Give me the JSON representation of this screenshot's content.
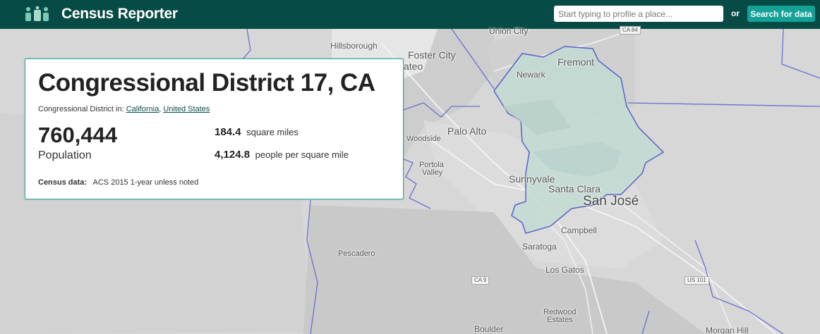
{
  "header": {
    "app_name": "Census Reporter",
    "search_placeholder": "Start typing to profile a place...",
    "or_label": "or",
    "search_button": "Search for data"
  },
  "profile": {
    "title": "Congressional District 17, CA",
    "parents_prefix": "Congressional District in:",
    "parent_links": [
      "California",
      "United States"
    ],
    "parent_separator": ",",
    "population_value": "760,444",
    "population_label": "Population",
    "area_value": "184.4",
    "area_unit": "square miles",
    "density_value": "4,124.8",
    "density_unit": "people per square mile",
    "census_label": "Census data:",
    "census_value": "ACS 2015 1-year unless noted"
  },
  "map": {
    "labels": [
      "Union City",
      "Hillsborough",
      "Foster City",
      "ateo",
      "Fremont",
      "Newark",
      "Palo Alto",
      "Woodside",
      "Portola",
      "Valley",
      "Sunnyvale",
      "Santa Clara",
      "San José",
      "Campbell",
      "Saratoga",
      "Los Gatos",
      "Pescadero",
      "Redwood",
      "Estates",
      "Boulder",
      "Morgan Hill"
    ],
    "shields": [
      "CA 84",
      "CA 9",
      "US 101"
    ],
    "colors": {
      "land": "#d9d9d9",
      "urban": "#cfcfcf",
      "district_fill": "#c5dcd5",
      "district_stroke": "#5a62c8",
      "boundary": "#6a6fd0",
      "road": "#ffffff"
    }
  },
  "colors": {
    "header_bg": "#064b45",
    "accent": "#14a297",
    "card_border": "#20a89c",
    "link": "#0b4f48"
  }
}
